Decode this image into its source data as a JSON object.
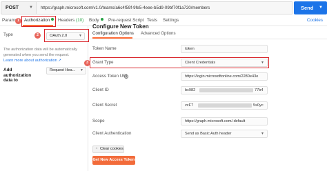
{
  "request": {
    "method": "POST",
    "url": "https://graph.microsoft.com/v1.0/teams/a6c4f59f-9fe5-4eee-b5d9-09bf70f1a720/members",
    "send_label": "Send"
  },
  "tabs": [
    {
      "label": "Params"
    },
    {
      "label": "Authorization"
    },
    {
      "label": "Headers",
      "count": "(10)"
    },
    {
      "label": "Body"
    },
    {
      "label": "Pre-request Script"
    },
    {
      "label": "Tests"
    },
    {
      "label": "Settings"
    }
  ],
  "cookies_label": "Cookies",
  "badges": [
    "1",
    "2",
    "3"
  ],
  "auth": {
    "type_label": "Type",
    "type_value": "OAuth 2.0",
    "note": "The authorization data will be automatically generated when you send the request.",
    "learn_more": "Learn more about authorization ↗",
    "add_to_label": "Add authorization data to",
    "add_to_value": "Request Hea..."
  },
  "config": {
    "heading": "Configure New Token",
    "subtabs": [
      "Configuration Options",
      "Advanced Options"
    ],
    "fields": [
      {
        "label": "Token Name",
        "value": "token"
      },
      {
        "label": "Grant Type",
        "value": "Client Credentials"
      },
      {
        "label": "Access Token URL",
        "value": "https://login.microsoftonline.com/2280e43e"
      },
      {
        "label": "Client ID",
        "value": "bc982",
        "tail": "77b4"
      },
      {
        "label": "Client Secret",
        "value": "vcF7",
        "tail": "5s0yc"
      },
      {
        "label": "Scope",
        "value": "https://graph.microsoft.com/.default"
      },
      {
        "label": "Client Authentication",
        "value": "Send as Basic Auth header"
      }
    ],
    "clear_cookies": "Clear cookies",
    "get_token": "Get New Access Token"
  },
  "colors": {
    "accent": "#ff6c37",
    "send": "#1c74e8",
    "annotation": "#d9262c"
  }
}
